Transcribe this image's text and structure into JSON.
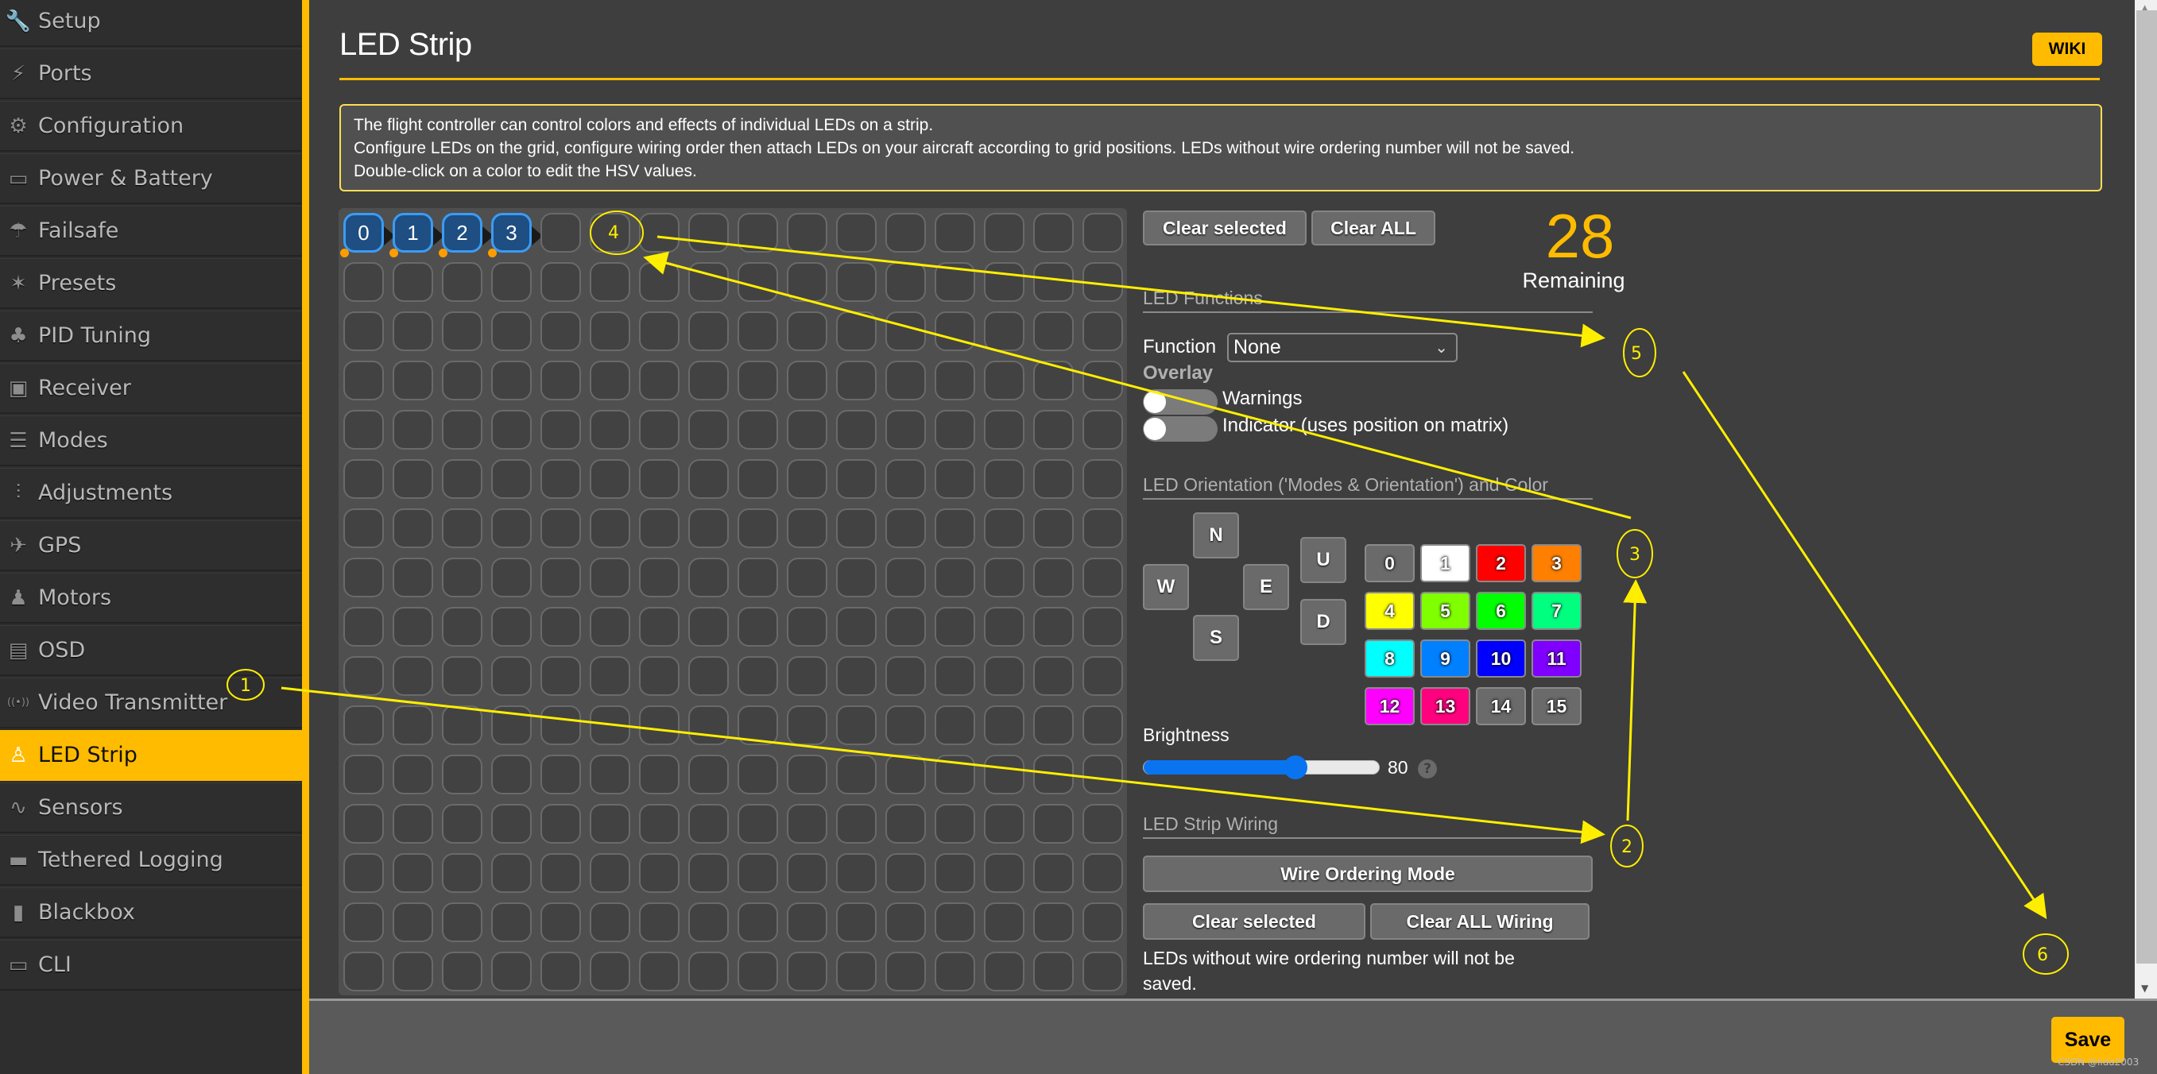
{
  "sidebar": {
    "items": [
      {
        "label": "Setup",
        "icon": "wrench-icon",
        "glyph": "🔧",
        "active": false
      },
      {
        "label": "Ports",
        "icon": "plug-icon",
        "glyph": "⚡",
        "active": false
      },
      {
        "label": "Configuration",
        "icon": "gear-icon",
        "glyph": "⚙",
        "active": false
      },
      {
        "label": "Power & Battery",
        "icon": "battery-icon",
        "glyph": "▭",
        "active": false
      },
      {
        "label": "Failsafe",
        "icon": "parachute-icon",
        "glyph": "☂",
        "active": false
      },
      {
        "label": "Presets",
        "icon": "magic-wand-icon",
        "glyph": "✶",
        "active": false
      },
      {
        "label": "PID Tuning",
        "icon": "sitemap-icon",
        "glyph": "♣",
        "active": false
      },
      {
        "label": "Receiver",
        "icon": "receiver-icon",
        "glyph": "▣",
        "active": false
      },
      {
        "label": "Modes",
        "icon": "toggle-icon",
        "glyph": "☰",
        "active": false
      },
      {
        "label": "Adjustments",
        "icon": "sliders-icon",
        "glyph": "⫶",
        "active": false
      },
      {
        "label": "GPS",
        "icon": "satellite-icon",
        "glyph": "✈",
        "active": false
      },
      {
        "label": "Motors",
        "icon": "motor-icon",
        "glyph": "♟",
        "active": false
      },
      {
        "label": "OSD",
        "icon": "osd-icon",
        "glyph": "▤",
        "active": false
      },
      {
        "label": "Video Transmitter",
        "icon": "antenna-icon",
        "glyph": "((•))",
        "active": false
      },
      {
        "label": "LED Strip",
        "icon": "led-icon",
        "glyph": "♙",
        "active": true
      },
      {
        "label": "Sensors",
        "icon": "pulse-icon",
        "glyph": "∿",
        "active": false
      },
      {
        "label": "Tethered Logging",
        "icon": "tape-icon",
        "glyph": "▬",
        "active": false
      },
      {
        "label": "Blackbox",
        "icon": "blackbox-icon",
        "glyph": "▮",
        "active": false
      },
      {
        "label": "CLI",
        "icon": "terminal-icon",
        "glyph": "▭",
        "active": false
      }
    ]
  },
  "header": {
    "title": "LED Strip",
    "wiki_label": "WIKI"
  },
  "info": {
    "lines": [
      "The flight controller can control colors and effects of individual LEDs on a strip.",
      "Configure LEDs on the grid, configure wiring order then attach LEDs on your aircraft according to grid positions. LEDs without wire ordering number will not be saved.",
      "Double-click on a color to edit the HSV values."
    ]
  },
  "grid": {
    "columns": 16,
    "rows": 16,
    "wired": [
      {
        "row": 0,
        "col": 0,
        "label": "0"
      },
      {
        "row": 0,
        "col": 1,
        "label": "1"
      },
      {
        "row": 0,
        "col": 2,
        "label": "2"
      },
      {
        "row": 0,
        "col": 3,
        "label": "3"
      }
    ]
  },
  "controls": {
    "clear_selected": "Clear selected",
    "clear_all": "Clear ALL",
    "remaining_count": "28",
    "remaining_label": "Remaining",
    "functions_heading": "LED Functions",
    "function_label": "Function",
    "function_value": "None",
    "overlay_heading": "Overlay",
    "overlay_toggles": [
      {
        "label": "Warnings",
        "on": false
      },
      {
        "label": "Indicator (uses position on matrix)",
        "on": false
      }
    ],
    "orientation_heading": "LED Orientation ('Modes & Orientation') and Color",
    "directions": {
      "n": "N",
      "w": "W",
      "e": "E",
      "s": "S",
      "u": "U",
      "d": "D"
    },
    "colors": [
      {
        "label": "0",
        "hex": "#6a6a6a"
      },
      {
        "label": "1",
        "hex": "#ffffff"
      },
      {
        "label": "2",
        "hex": "#ff0000"
      },
      {
        "label": "3",
        "hex": "#ff7f00"
      },
      {
        "label": "4",
        "hex": "#ffff00"
      },
      {
        "label": "5",
        "hex": "#7fff00"
      },
      {
        "label": "6",
        "hex": "#00ff00"
      },
      {
        "label": "7",
        "hex": "#00ff7f"
      },
      {
        "label": "8",
        "hex": "#00ffff"
      },
      {
        "label": "9",
        "hex": "#007fff"
      },
      {
        "label": "10",
        "hex": "#0000ff"
      },
      {
        "label": "11",
        "hex": "#7f00ff"
      },
      {
        "label": "12",
        "hex": "#ff00ff"
      },
      {
        "label": "13",
        "hex": "#ff007f"
      },
      {
        "label": "14",
        "hex": "#6a6a6a"
      },
      {
        "label": "15",
        "hex": "#6a6a6a"
      }
    ],
    "brightness_label": "Brightness",
    "brightness_value": "80",
    "brightness_fraction": 0.8,
    "help_glyph": "?",
    "wiring_heading": "LED Strip Wiring",
    "wire_ordering_mode": "Wire Ordering Mode",
    "wiring_clear_selected": "Clear selected",
    "wiring_clear_all": "Clear ALL Wiring",
    "wiring_note": "LEDs without wire ordering number will not be saved."
  },
  "footer": {
    "save_label": "Save",
    "watermark": "CSDN @lida2003"
  },
  "annotations": [
    {
      "label": "1"
    },
    {
      "label": "2"
    },
    {
      "label": "3"
    },
    {
      "label": "4"
    },
    {
      "label": "5"
    },
    {
      "label": "6"
    }
  ],
  "colors": {
    "accent": "#ffbb00",
    "annotation": "#ffee00",
    "wired_led_fill": "#1e4e82",
    "wired_led_border": "#3b9cf4"
  }
}
